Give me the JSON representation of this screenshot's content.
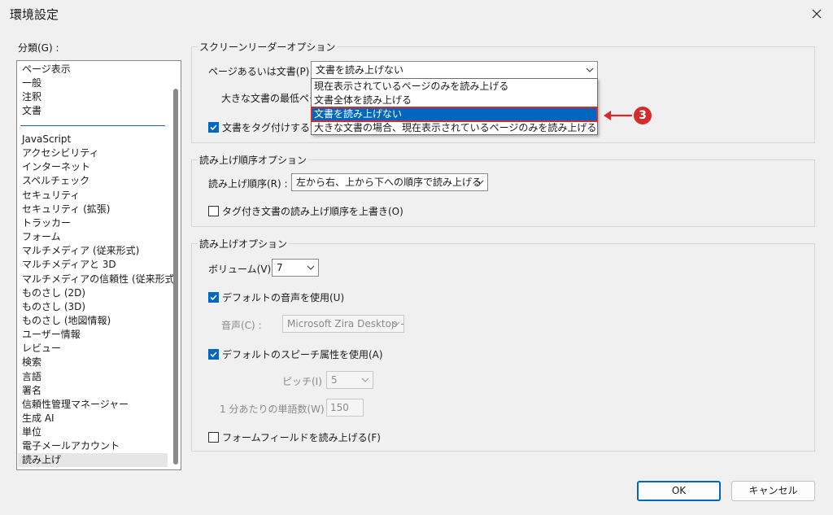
{
  "window": {
    "title": "環境設定"
  },
  "categories": {
    "label": "分類(G) :",
    "items_top": [
      "ページ表示",
      "一般",
      "注釈",
      "文書"
    ],
    "items": [
      "JavaScript",
      "アクセシビリティ",
      "インターネット",
      "スペルチェック",
      "セキュリティ",
      "セキュリティ (拡張)",
      "トラッカー",
      "フォーム",
      "マルチメディア (従来形式)",
      "マルチメディアと 3D",
      "マルチメディアの信頼性 (従来形式)",
      "ものさし (2D)",
      "ものさし (3D)",
      "ものさし (地図情報)",
      "ユーザー情報",
      "レビュー",
      "検索",
      "言語",
      "署名",
      "信頼性管理マネージャー",
      "生成 AI",
      "単位",
      "電子メールアカウント",
      "読み上げ"
    ],
    "selected": "読み上げ"
  },
  "screen_reader": {
    "group_title": "スクリーンリーダーオプション",
    "page_label": "ページあるいは文書(P) :",
    "page_value": "文書を読み上げない",
    "large_doc_label": "大きな文書の最低ペー",
    "tag_label": "文書をタグ付けする前に"
  },
  "dropdown": {
    "options": [
      "現在表示されているページのみを読み上げる",
      "文書全体を読み上げる",
      "文書を読み上げない",
      "大きな文書の場合、現在表示されているページのみを読み上げる"
    ],
    "highlighted": "文書を読み上げない"
  },
  "annotation": {
    "number": "3",
    "color": "#d62b2b"
  },
  "reading_order": {
    "group_title": "読み上げ順序オプション",
    "order_label": "読み上げ順序(R) :",
    "order_value": "左から右、上から下への順序で読み上げる",
    "override_label": "タグ付き文書の読み上げ順序を上書き(O)"
  },
  "reading": {
    "group_title": "読み上げオプション",
    "volume_label": "ボリューム(V) :",
    "volume_value": "7",
    "default_voice_label": "デフォルトの音声を使用(U)",
    "voice_label": "音声(C) :",
    "voice_value": "Microsoft Zira Desktop -",
    "default_speech_label": "デフォルトのスピーチ属性を使用(A)",
    "pitch_label": "ピッチ(I) :",
    "pitch_value": "5",
    "wpm_label": "1 分あたりの単語数(W) :",
    "wpm_value": "150",
    "form_fields_label": "フォームフィールドを読み上げる(F)"
  },
  "buttons": {
    "ok": "OK",
    "cancel": "キャンセル"
  },
  "colors": {
    "accent": "#0067c0",
    "annotation": "#d62b2b"
  }
}
